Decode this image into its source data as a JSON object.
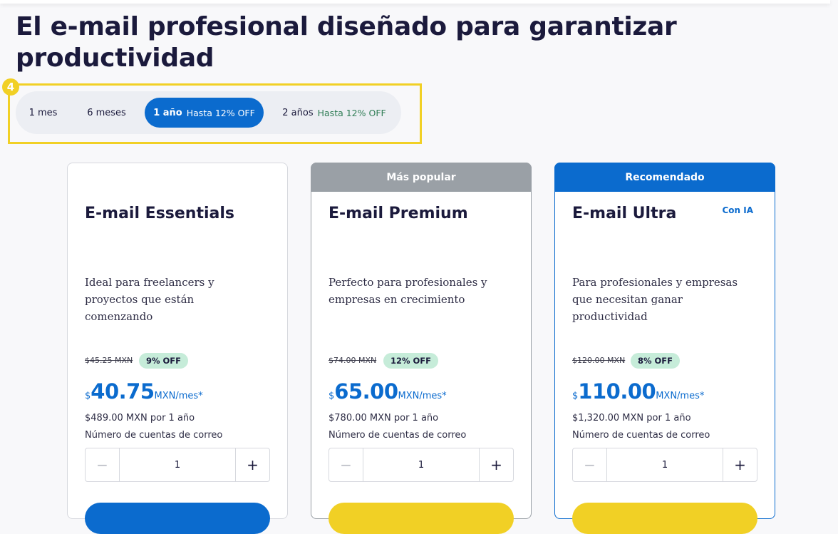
{
  "page": {
    "title": "El e-mail profesional diseñado para garantizar productividad",
    "annotation_number": "4"
  },
  "period_tabs": [
    {
      "label": "1 mes",
      "offer": ""
    },
    {
      "label": "6 meses",
      "offer": ""
    },
    {
      "label": "1 año",
      "offer": "Hasta 12% OFF",
      "selected": true
    },
    {
      "label": "2 años",
      "offer": "Hasta 12% OFF"
    }
  ],
  "plans": [
    {
      "banner": "",
      "name": "E-mail Essentials",
      "tag": "",
      "description": "Ideal para freelancers y proyectos que están comenzando",
      "old_price": "$45.25 MXN",
      "discount": "9% OFF",
      "currency": "$",
      "price": "40.75",
      "price_unit": "MXN/mes*",
      "yearly_total": "$489.00 MXN por 1 año",
      "accounts_label": "Número de cuentas de correo",
      "quantity": "1"
    },
    {
      "banner": "Más popular",
      "name": "E-mail Premium",
      "tag": "",
      "description": "Perfecto para profesionales y empresas en crecimiento",
      "old_price": "$74.00 MXN",
      "discount": "12% OFF",
      "currency": "$",
      "price": "65.00",
      "price_unit": "MXN/mes*",
      "yearly_total": "$780.00 MXN por 1 año",
      "accounts_label": "Número de cuentas de correo",
      "quantity": "1"
    },
    {
      "banner": "Recomendado",
      "name": "E-mail Ultra",
      "tag": "Con IA",
      "description": "Para profesionales y empresas que necesitan ganar productividad",
      "old_price": "$120.00 MXN",
      "discount": "8% OFF",
      "currency": "$",
      "price": "110.00",
      "price_unit": "MXN/mes*",
      "yearly_total": "$1,320.00 MXN por 1 año",
      "accounts_label": "Número de cuentas de correo",
      "quantity": "1"
    }
  ],
  "stepper": {
    "minus": "−",
    "plus": "+"
  },
  "colors": {
    "accent": "#0b6bce",
    "highlight": "#f1d025",
    "popular_banner": "#9aa0a6",
    "discount_badge": "#c6ecd9"
  }
}
